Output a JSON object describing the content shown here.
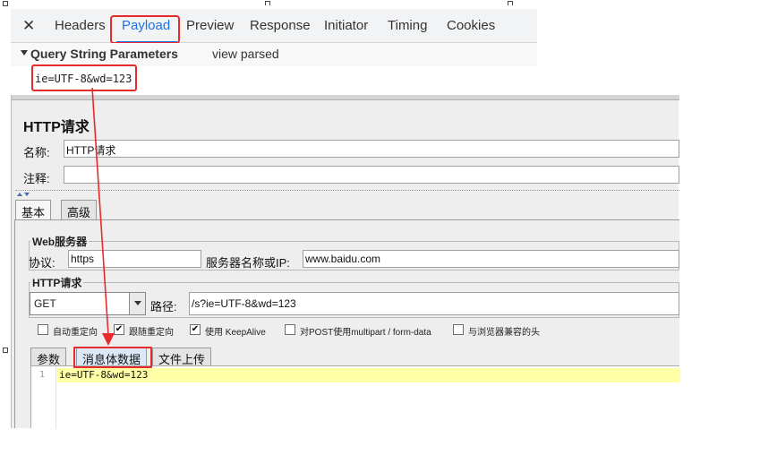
{
  "devtools": {
    "close_glyph": "✕",
    "tabs": [
      "Headers",
      "Payload",
      "Preview",
      "Response",
      "Initiator",
      "Timing",
      "Cookies"
    ],
    "active_tab": "Payload",
    "section_title": "Query String Parameters",
    "view_parsed": "view parsed",
    "query_string": "ie=UTF-8&wd=123"
  },
  "jmeter": {
    "title": "HTTP请求",
    "name_label": "名称:",
    "name_value": "HTTP请求",
    "comment_label": "注释:",
    "comment_value": "",
    "tabs": [
      "基本",
      "高级"
    ],
    "web_server_group": "Web服务器",
    "protocol_label": "协议:",
    "protocol_value": "https",
    "server_label": "服务器名称或IP:",
    "server_value": "www.baidu.com",
    "http_request_group": "HTTP请求",
    "method": "GET",
    "path_label": "路径:",
    "path_value": "/s?ie=UTF-8&wd=123",
    "checkboxes": [
      {
        "label": "自动重定向",
        "checked": false
      },
      {
        "label": "跟随重定向",
        "checked": true
      },
      {
        "label": "使用 KeepAlive",
        "checked": true
      },
      {
        "label": "对POST使用multipart / form-data",
        "checked": false
      },
      {
        "label": "与浏览器兼容的头",
        "checked": false
      }
    ],
    "subtabs": [
      "参数",
      "消息体数据",
      "文件上传"
    ],
    "active_subtab": "消息体数据",
    "body_line_number": "1",
    "body_text": "ie=UTF-8&wd=123"
  },
  "colors": {
    "annotation_red": "#e52b2b",
    "devtools_accent": "#1a73e8",
    "editor_highlight": "#ffffa6"
  }
}
